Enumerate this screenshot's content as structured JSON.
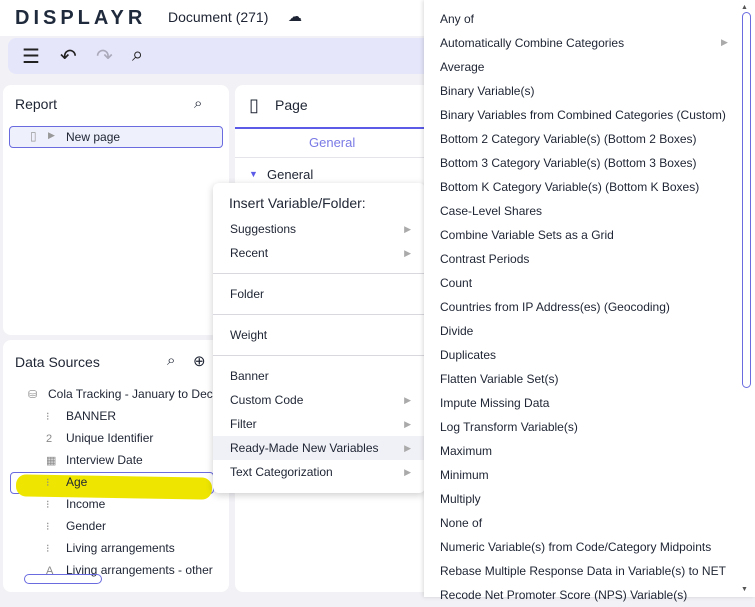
{
  "header": {
    "logo": "DISPLAYR",
    "document_title": "Document (271)"
  },
  "report": {
    "title": "Report",
    "page_item": "New page"
  },
  "data_sources": {
    "title": "Data Sources",
    "dataset": "Cola Tracking - January to Dec",
    "items": [
      {
        "icon": "⁝",
        "label": "BANNER"
      },
      {
        "icon": "2",
        "label": "Unique Identifier"
      },
      {
        "icon": "▦",
        "label": "Interview Date"
      },
      {
        "icon": "⁝",
        "label": "Age"
      },
      {
        "icon": "⁝",
        "label": "Income"
      },
      {
        "icon": "⁝",
        "label": "Gender"
      },
      {
        "icon": "⁝",
        "label": "Living arrangements"
      },
      {
        "icon": "A",
        "label": "Living arrangements - other"
      }
    ]
  },
  "page_panel": {
    "title": "Page",
    "tab": "General",
    "section": "General"
  },
  "menu": {
    "title": "Insert Variable/Folder:",
    "suggestions": "Suggestions",
    "recent": "Recent",
    "folder": "Folder",
    "weight": "Weight",
    "banner": "Banner",
    "custom_code": "Custom Code",
    "filter": "Filter",
    "ready_made": "Ready-Made New Variables",
    "text_cat": "Text Categorization"
  },
  "submenu": [
    "Any of",
    "Automatically Combine Categories",
    "Average",
    "Binary Variable(s)",
    "Binary Variables from Combined Categories (Custom)",
    "Bottom 2 Category Variable(s) (Bottom 2 Boxes)",
    "Bottom 3 Category Variable(s) (Bottom 3 Boxes)",
    "Bottom K Category Variable(s) (Bottom K Boxes)",
    "Case-Level Shares",
    "Combine Variable Sets as a Grid",
    "Contrast Periods",
    "Count",
    "Countries from IP Address(es) (Geocoding)",
    "Divide",
    "Duplicates",
    "Flatten Variable Set(s)",
    "Impute Missing Data",
    "Log Transform Variable(s)",
    "Maximum",
    "Minimum",
    "Multiply",
    "None of",
    "Numeric Variable(s) from Code/Category Midpoints",
    "Rebase Multiple Response Data in Variable(s) to NET",
    "Recode Net Promoter Score (NPS) Variable(s)"
  ]
}
